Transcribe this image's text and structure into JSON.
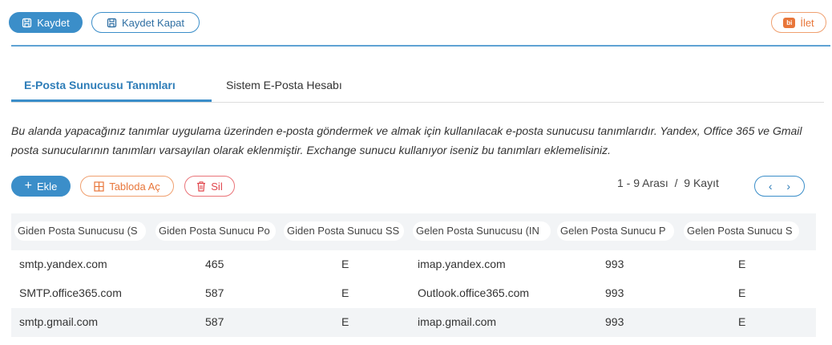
{
  "toolbar": {
    "save_label": "Kaydet",
    "save_close_label": "Kaydet Kapat",
    "forward_label": "İlet",
    "forward_badge": "bi"
  },
  "tabs": [
    {
      "label": "E-Posta Sunucusu Tanımları",
      "active": true
    },
    {
      "label": "Sistem E-Posta Hesabı",
      "active": false
    }
  ],
  "description": "Bu alanda yapacağınız tanımlar uygulama üzerinden e-posta göndermek ve almak için kullanılacak e-posta sunucusu tanımlarıdır. Yandex, Office 365 ve Gmail posta sunucularının tanımları varsayılan olarak eklenmiştir. Exchange sunucu kullanıyor iseniz bu tanımları eklemelisiniz.",
  "actions": {
    "add_label": "Ekle",
    "open_table_label": "Tabloda Aç",
    "delete_label": "Sil"
  },
  "pagination": {
    "range": "1 - 9 Arası",
    "separator": "/",
    "total": "9 Kayıt"
  },
  "table": {
    "columns": [
      "Giden Posta Sunucusu (S",
      "Giden Posta Sunucu Po",
      "Giden Posta Sunucu SS",
      "Gelen Posta Sunucusu (IN",
      "Gelen Posta Sunucu P",
      "Gelen Posta Sunucu S"
    ],
    "rows": [
      [
        "smtp.yandex.com",
        "465",
        "E",
        "imap.yandex.com",
        "993",
        "E"
      ],
      [
        "SMTP.office365.com",
        "587",
        "E",
        "Outlook.office365.com",
        "993",
        "E"
      ],
      [
        "smtp.gmail.com",
        "587",
        "E",
        "imap.gmail.com",
        "993",
        "E"
      ]
    ]
  },
  "colors": {
    "primary": "#3b8ec9",
    "orange": "#e8763a",
    "red": "#e0454b"
  }
}
